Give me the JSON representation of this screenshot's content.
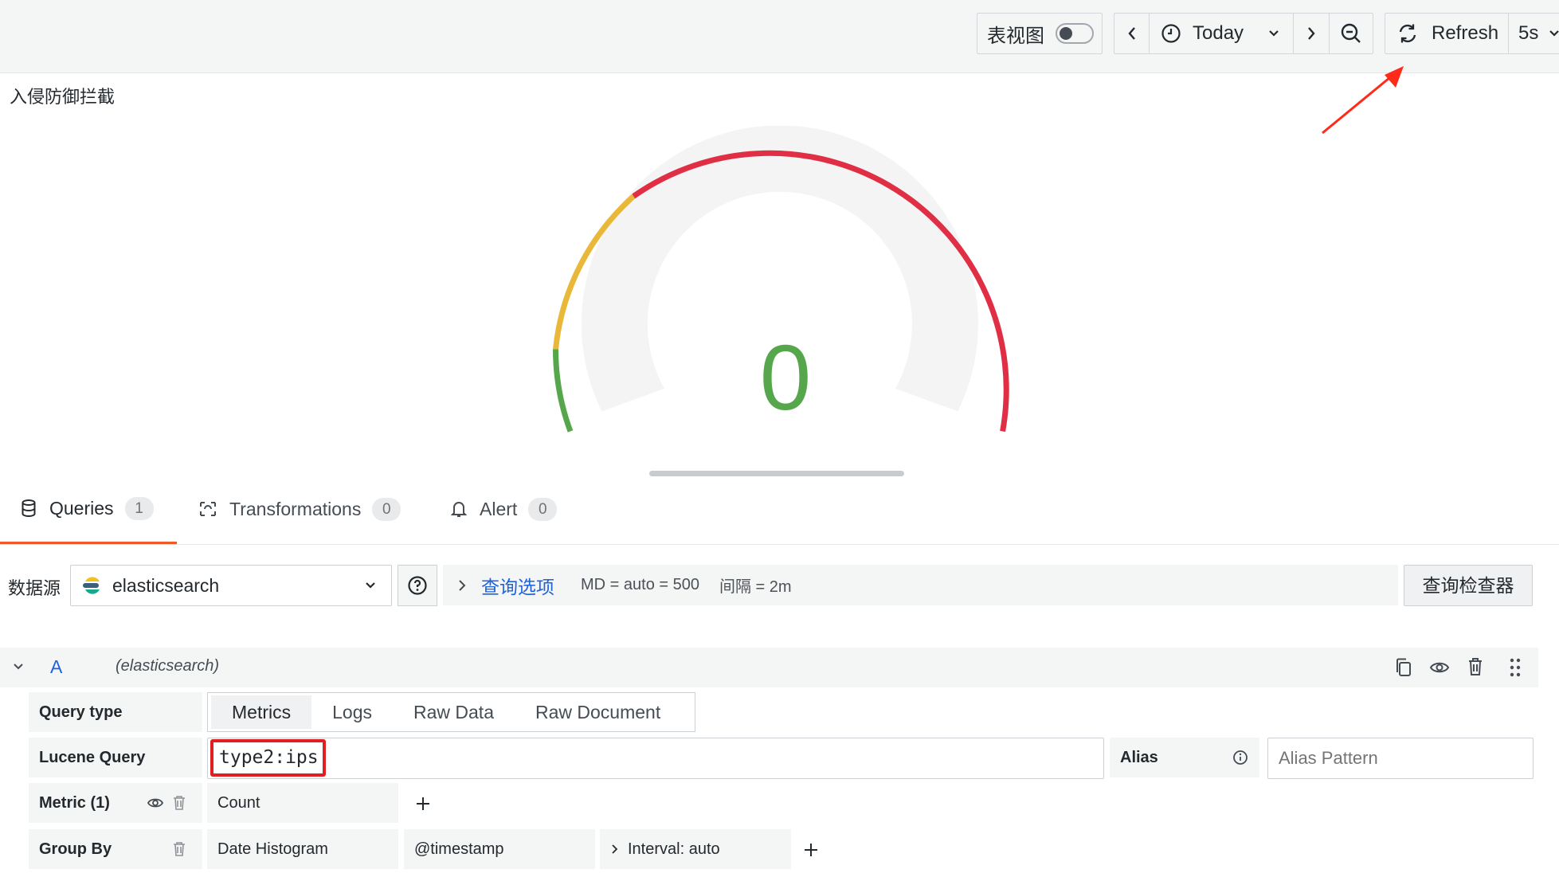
{
  "toolbar": {
    "table_view_label": "表视图",
    "time_range": "Today",
    "refresh_label": "Refresh",
    "refresh_interval": "5s"
  },
  "panel": {
    "title": "入侵防御拦截",
    "value": "0",
    "gauge": {
      "value": 0,
      "colors": {
        "green": "#56a64b",
        "yellow": "#eab839",
        "red": "#e02f44",
        "track": "#f4f4f4"
      }
    }
  },
  "tabs": [
    {
      "label": "Queries",
      "count": "1",
      "active": true,
      "icon": "database-icon"
    },
    {
      "label": "Transformations",
      "count": "0",
      "active": false,
      "icon": "transform-icon"
    },
    {
      "label": "Alert",
      "count": "0",
      "active": false,
      "icon": "bell-icon"
    }
  ],
  "datasource": {
    "label": "数据源",
    "selected": "elasticsearch",
    "query_options_link": "查询选项",
    "md_info": "MD = auto = 500",
    "interval_info": "间隔 = 2m",
    "inspector_button": "查询检查器"
  },
  "query": {
    "ref_id": "A",
    "datasource_name": "(elasticsearch)",
    "query_type_label": "Query type",
    "query_types": [
      "Metrics",
      "Logs",
      "Raw Data",
      "Raw Document"
    ],
    "active_query_type": "Metrics",
    "lucene_label": "Lucene Query",
    "lucene_value": "type2:ips",
    "alias_label": "Alias",
    "alias_placeholder": "Alias Pattern",
    "metric_label": "Metric (1)",
    "metric_value": "Count",
    "group_by_label": "Group By",
    "group_by_type": "Date Histogram",
    "group_by_field": "@timestamp",
    "group_by_interval": "Interval: auto"
  },
  "accent_colors": {
    "link": "#1f62e0",
    "highlight_box": "#e02020",
    "active_tab_underline": "#f05a28",
    "arrow": "#ff2a1a"
  }
}
